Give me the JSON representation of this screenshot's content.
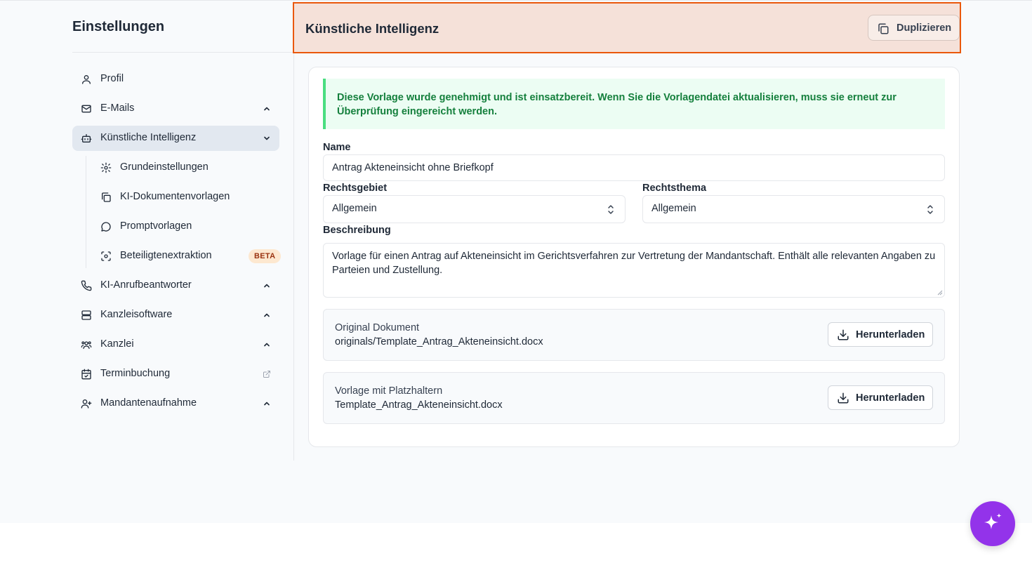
{
  "sidebar": {
    "title": "Einstellungen",
    "items": [
      {
        "label": "Profil",
        "icon": "user-icon"
      },
      {
        "label": "E-Mails",
        "icon": "mail-icon",
        "chevron": "up"
      },
      {
        "label": "Künstliche Intelligenz",
        "icon": "bot-icon",
        "chevron": "down",
        "active": true
      },
      {
        "label": "KI-Anrufbeantworter",
        "icon": "phone-icon",
        "chevron": "up"
      },
      {
        "label": "Kanzleisoftware",
        "icon": "server-icon",
        "chevron": "up"
      },
      {
        "label": "Kanzlei",
        "icon": "users-icon",
        "chevron": "up"
      },
      {
        "label": "Terminbuchung",
        "icon": "calendar-check-icon",
        "external": true
      },
      {
        "label": "Mandantenaufnahme",
        "icon": "user-plus-icon",
        "chevron": "up"
      }
    ],
    "subitems": [
      {
        "label": "Grundeinstellungen",
        "icon": "gear-icon"
      },
      {
        "label": "KI-Dokumentenvorlagen",
        "icon": "copy-icon"
      },
      {
        "label": "Promptvorlagen",
        "icon": "message-circle-icon"
      },
      {
        "label": "Beteiligtenextraktion",
        "icon": "scan-face-icon",
        "badge": "BETA"
      }
    ]
  },
  "header": {
    "title": "Künstliche Intelligenz",
    "duplicate_label": "Duplizieren"
  },
  "alert": {
    "text": "Diese Vorlage wurde genehmigt und ist einsatzbereit. Wenn Sie die Vorlagendatei aktualisieren, muss sie erneut zur Überprüfung eingereicht werden."
  },
  "form": {
    "name_label": "Name",
    "name_value": "Antrag Akteneinsicht ohne Briefkopf",
    "rechtsgebiet_label": "Rechtsgebiet",
    "rechtsgebiet_value": "Allgemein",
    "rechtsthema_label": "Rechtsthema",
    "rechtsthema_value": "Allgemein",
    "beschreibung_label": "Beschreibung",
    "beschreibung_value": "Vorlage für einen Antrag auf Akteneinsicht im Gerichtsverfahren zur Vertretung der Mandantschaft. Enthält alle relevanten Angaben zu Parteien und Zustellung."
  },
  "files": [
    {
      "label": "Original Dokument",
      "value": "originals/Template_Antrag_Akteneinsicht.docx",
      "button": "Herunterladen"
    },
    {
      "label": "Vorlage mit Platzhaltern",
      "value": "Template_Antrag_Akteneinsicht.docx",
      "button": "Herunterladen"
    }
  ],
  "colors": {
    "accent": "#ea580c",
    "fab": "#9333ea",
    "success_text": "#15803d",
    "success_bg": "#ecfdf3"
  },
  "fab_icon": "sparkles-icon"
}
